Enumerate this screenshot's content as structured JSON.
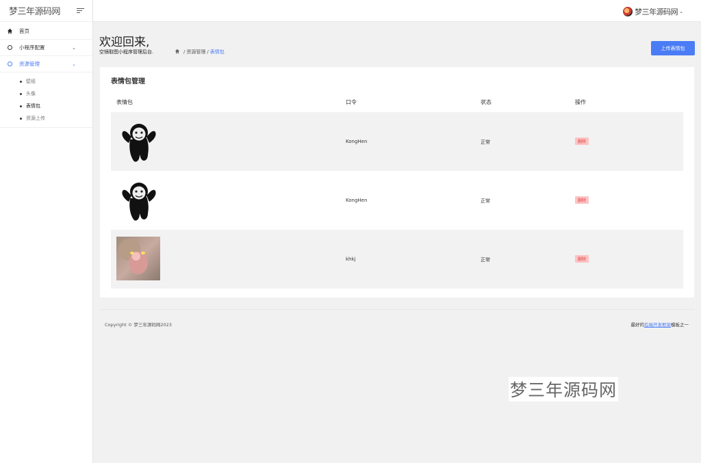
{
  "sidebar": {
    "brand": "梦三年源码网",
    "items": [
      {
        "label": "首页",
        "icon": "home-icon"
      },
      {
        "label": "小程序配置",
        "icon": "circle-icon"
      },
      {
        "label": "资源管理",
        "icon": "circle-icon"
      }
    ],
    "subitems": [
      "壁纸",
      "头像",
      "表情包",
      "资源上传"
    ]
  },
  "topbar": {
    "username": "梦三年源码网"
  },
  "header": {
    "welcome": "欢迎回来,",
    "subtitle": "空镜取图小程序管理后台.",
    "breadcrumb": [
      "资源管理",
      "表情包"
    ],
    "upload_label": "上传表情包"
  },
  "card": {
    "title": "表情包管理",
    "columns": [
      "表情包",
      "口令",
      "状态",
      "操作"
    ],
    "rows": [
      {
        "code": "KongHen",
        "status": "正常",
        "action": "删除"
      },
      {
        "code": "KongHen",
        "status": "正常",
        "action": "删除"
      },
      {
        "code": "khkj",
        "status": "正常",
        "action": "删除"
      }
    ]
  },
  "footer": {
    "copyright": "Copyright © 梦三年源码网2023",
    "right_prefix": "最好的",
    "right_link": "后端开发框架",
    "right_suffix": "模板之一"
  },
  "watermark": "梦三年源码网",
  "colors": {
    "accent": "#4a7cf6",
    "delete_bg": "#fbc4c4",
    "delete_text": "#e24343"
  }
}
